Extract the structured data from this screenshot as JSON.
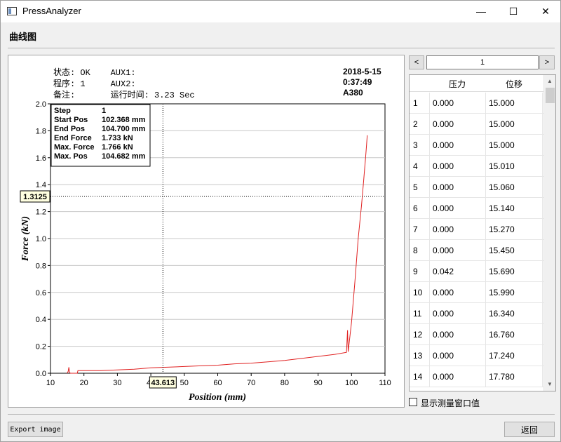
{
  "window": {
    "title": "PressAnalyzer",
    "min_glyph": "—",
    "max_glyph": "☐",
    "close_glyph": "✕"
  },
  "section_title": "曲线图",
  "header_info": {
    "status_line": "状态: OK    AUX1:",
    "program_line": "程序: 1     AUX2:",
    "note_line": "备注:       运行时间: 3.23 Sec",
    "date": "2018-5-15",
    "time": "0:37:49",
    "model": "A380"
  },
  "info_box": [
    {
      "label": "Step",
      "value": "1"
    },
    {
      "label": "Start Pos",
      "value": "102.368 mm"
    },
    {
      "label": "End Pos",
      "value": "104.700 mm"
    },
    {
      "label": "End Force",
      "value": "1.733 kN"
    },
    {
      "label": "Max. Force",
      "value": "1.766 kN"
    },
    {
      "label": "Max. Pos",
      "value": "104.682 mm"
    }
  ],
  "cursor": {
    "x_value": 43.613,
    "x_label": "43.613",
    "y_value": 1.3125,
    "y_label": "1.3125"
  },
  "chart_data": {
    "type": "line",
    "xlabel": "Position (mm)",
    "ylabel": "Force (kN)",
    "xlim": [
      10,
      110
    ],
    "ylim": [
      0,
      2.0
    ],
    "x_ticks": [
      "10",
      "20",
      "30",
      "40",
      "50",
      "60",
      "70",
      "80",
      "90",
      "100",
      "110"
    ],
    "y_ticks": [
      "0.0",
      "0.2",
      "0.4",
      "0.6",
      "0.8",
      "1.0",
      "1.2",
      "1.4",
      "1.6",
      "1.8",
      "2.0"
    ],
    "grid": "horizontal",
    "series": [
      {
        "color": "#e02020",
        "x": [
          15.0,
          15.3,
          15.5,
          15.7,
          16.0,
          17.0,
          18.0,
          18.2,
          20,
          25,
          30,
          35,
          40,
          45,
          50,
          55,
          60,
          65,
          70,
          75,
          80,
          85,
          90,
          95,
          98.5,
          98.8,
          99.0,
          100.0,
          101.0,
          102.0,
          103.0,
          103.7,
          104.2,
          104.5,
          104.7
        ],
        "y": [
          0.0,
          0.015,
          0.045,
          0.005,
          0.0,
          0.0,
          0.0,
          0.02,
          0.02,
          0.02,
          0.025,
          0.03,
          0.04,
          0.045,
          0.05,
          0.055,
          0.06,
          0.07,
          0.075,
          0.085,
          0.095,
          0.11,
          0.125,
          0.14,
          0.155,
          0.32,
          0.16,
          0.38,
          0.68,
          1.0,
          1.25,
          1.45,
          1.6,
          1.7,
          1.766
        ]
      }
    ]
  },
  "pager": {
    "value": "1",
    "prev": "<",
    "next": ">"
  },
  "table": {
    "headers": [
      "压力",
      "位移"
    ],
    "rows": [
      {
        "n": "1",
        "force": "0.000",
        "disp": "15.000"
      },
      {
        "n": "2",
        "force": "0.000",
        "disp": "15.000"
      },
      {
        "n": "3",
        "force": "0.000",
        "disp": "15.000"
      },
      {
        "n": "4",
        "force": "0.000",
        "disp": "15.010"
      },
      {
        "n": "5",
        "force": "0.000",
        "disp": "15.060"
      },
      {
        "n": "6",
        "force": "0.000",
        "disp": "15.140"
      },
      {
        "n": "7",
        "force": "0.000",
        "disp": "15.270"
      },
      {
        "n": "8",
        "force": "0.000",
        "disp": "15.450"
      },
      {
        "n": "9",
        "force": "0.042",
        "disp": "15.690"
      },
      {
        "n": "10",
        "force": "0.000",
        "disp": "15.990"
      },
      {
        "n": "11",
        "force": "0.000",
        "disp": "16.340"
      },
      {
        "n": "12",
        "force": "0.000",
        "disp": "16.760"
      },
      {
        "n": "13",
        "force": "0.000",
        "disp": "17.240"
      },
      {
        "n": "14",
        "force": "0.000",
        "disp": "17.780"
      }
    ]
  },
  "measure_checkbox": {
    "label": "显示测量窗口值",
    "checked": false
  },
  "buttons": {
    "export": "Export image",
    "back": "返回"
  }
}
